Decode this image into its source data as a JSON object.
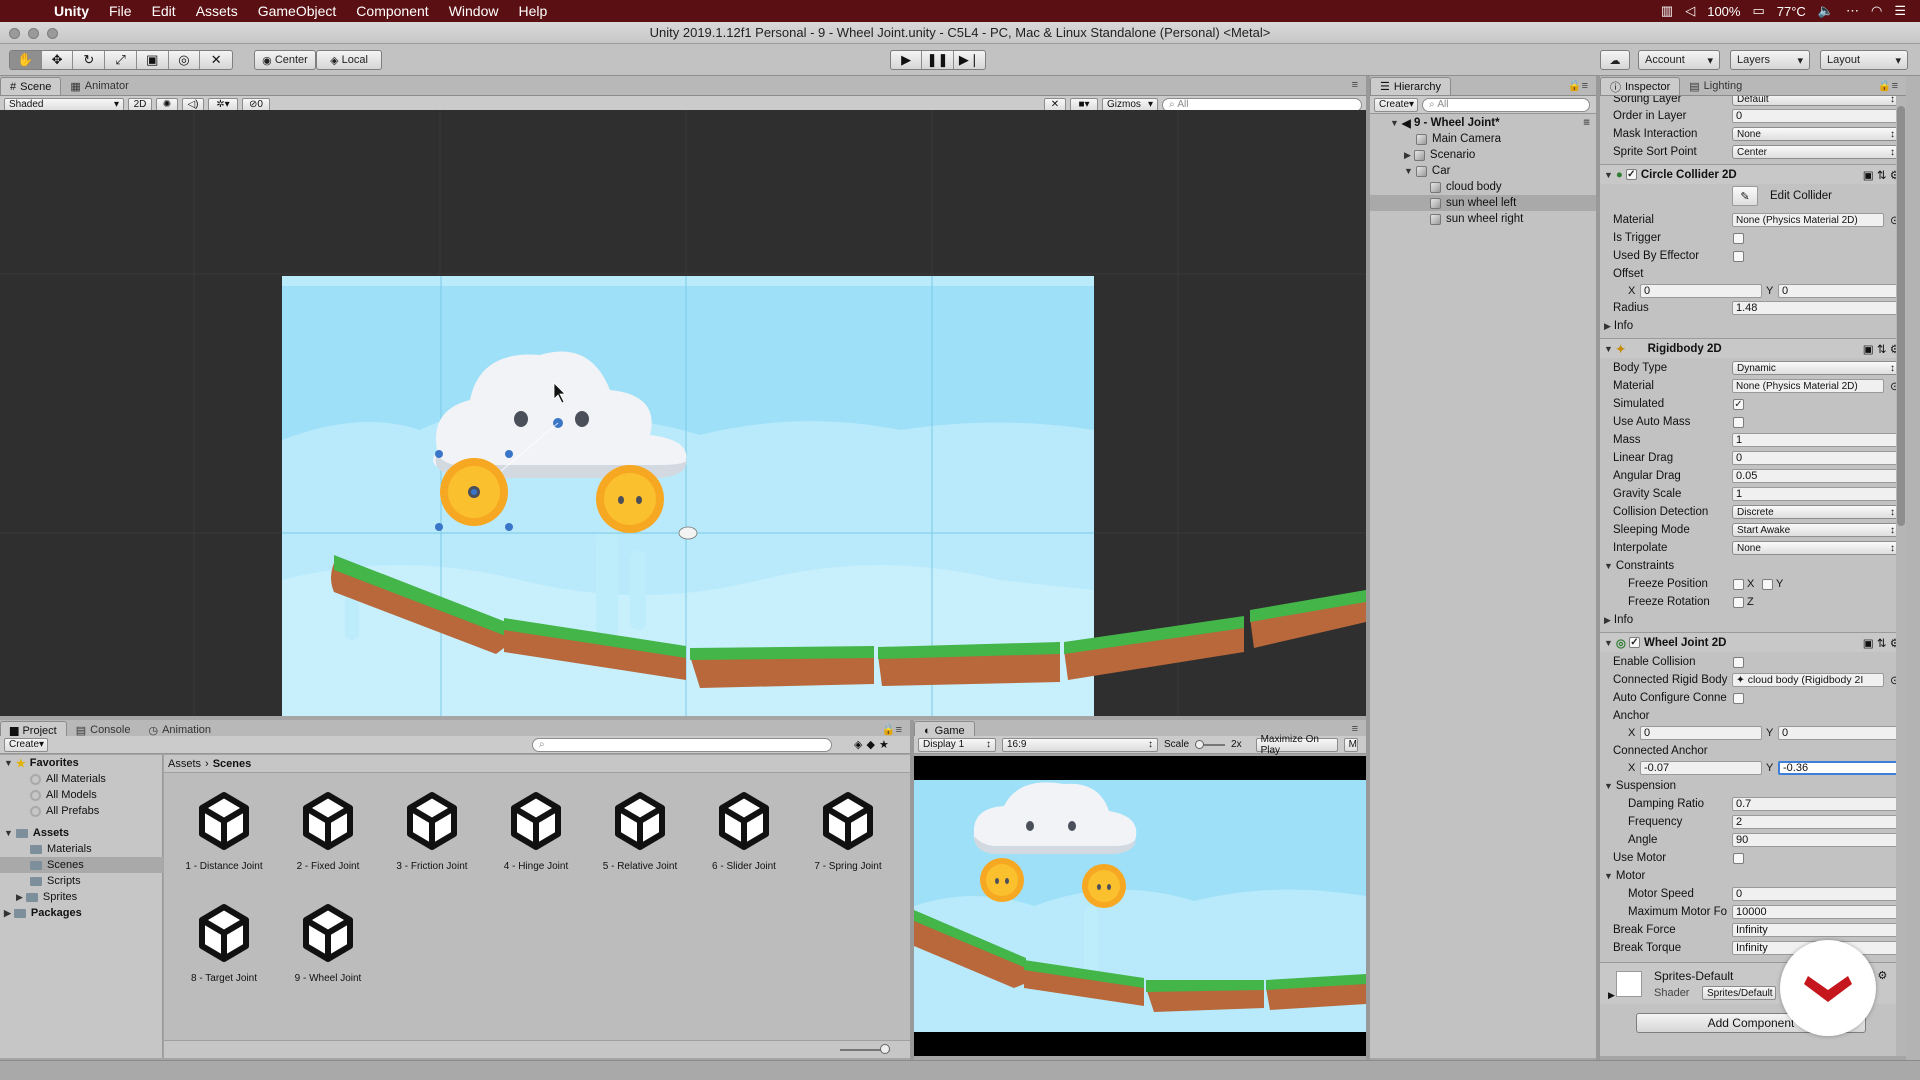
{
  "menubar": {
    "app": "Unity",
    "items": [
      "File",
      "Edit",
      "Assets",
      "GameObject",
      "Component",
      "Window",
      "Help"
    ],
    "status": {
      "battery": "100%",
      "weather": "77°C"
    }
  },
  "titlebar": {
    "title": "Unity 2019.1.12f1 Personal - 9 - Wheel Joint.unity - C5L4 - PC, Mac & Linux Standalone (Personal) <Metal>"
  },
  "toolbar": {
    "pivot": "Center",
    "space": "Local",
    "account": "Account",
    "layers": "Layers",
    "layout": "Layout"
  },
  "scene_panel": {
    "tabs": [
      "Scene",
      "Animator"
    ],
    "shading": "Shaded",
    "mode2d": "2D",
    "fx_count": "0",
    "gizmos": "Gizmos",
    "search_placeholder": "All"
  },
  "hierarchy": {
    "tab": "Hierarchy",
    "create": "Create",
    "search_placeholder": "All",
    "scene": "9 - Wheel Joint*",
    "items": [
      {
        "label": "Main Camera"
      },
      {
        "label": "Scenario"
      },
      {
        "label": "Car"
      },
      {
        "label": "cloud body"
      },
      {
        "label": "sun wheel left"
      },
      {
        "label": "sun wheel right"
      }
    ]
  },
  "inspector": {
    "tabs": [
      "Inspector",
      "Lighting"
    ],
    "sprite_renderer": {
      "sorting_layer_label": "Sorting Layer",
      "sorting_layer": "Default",
      "order_label": "Order in Layer",
      "order": "0",
      "mask_label": "Mask Interaction",
      "mask": "None",
      "sort_point_label": "Sprite Sort Point",
      "sort_point": "Center"
    },
    "circle_collider": {
      "title": "Circle Collider 2D",
      "edit": "Edit Collider",
      "material_label": "Material",
      "material": "None (Physics Material 2D)",
      "trigger_label": "Is Trigger",
      "effector_label": "Used By Effector",
      "offset_label": "Offset",
      "offset_x": "0",
      "offset_y": "0",
      "radius_label": "Radius",
      "radius": "1.48",
      "info": "Info"
    },
    "rigidbody": {
      "title": "Rigidbody 2D",
      "body_type_label": "Body Type",
      "body_type": "Dynamic",
      "material_label": "Material",
      "material": "None (Physics Material 2D)",
      "simulated_label": "Simulated",
      "auto_mass_label": "Use Auto Mass",
      "mass_label": "Mass",
      "mass": "1",
      "linear_drag_label": "Linear Drag",
      "linear_drag": "0",
      "angular_drag_label": "Angular Drag",
      "angular_drag": "0.05",
      "gravity_label": "Gravity Scale",
      "gravity": "1",
      "collision_label": "Collision Detection",
      "collision": "Discrete",
      "sleeping_label": "Sleeping Mode",
      "sleeping": "Start Awake",
      "interpolate_label": "Interpolate",
      "interpolate": "None",
      "constraints": "Constraints",
      "freeze_pos_label": "Freeze Position",
      "freeze_rot_label": "Freeze Rotation",
      "info": "Info"
    },
    "wheel_joint": {
      "title": "Wheel Joint 2D",
      "enable_collision_label": "Enable Collision",
      "connected_label": "Connected Rigid Body",
      "connected": "cloud body (Rigidbody 2I",
      "auto_configure_label": "Auto Configure Conne",
      "anchor_label": "Anchor",
      "anchor_x": "0",
      "anchor_y": "0",
      "connected_anchor_label": "Connected Anchor",
      "connected_anchor_x": "-0.07",
      "connected_anchor_y": "-0.36",
      "suspension": "Suspension",
      "damping_label": "Damping Ratio",
      "damping": "0.7",
      "frequency_label": "Frequency",
      "frequency": "2",
      "angle_label": "Angle",
      "angle": "90",
      "use_motor_label": "Use Motor",
      "motor": "Motor",
      "motor_speed_label": "Motor Speed",
      "motor_speed": "0",
      "max_force_label": "Maximum Motor Fo",
      "max_force": "10000",
      "break_force_label": "Break Force",
      "break_force": "Infinity",
      "break_torque_label": "Break Torque",
      "break_torque": "Infinity"
    },
    "material_block": {
      "name": "Sprites-Default",
      "shader_label": "Shader",
      "shader": "Sprites/Default"
    },
    "add_component": "Add Component"
  },
  "project": {
    "tabs": [
      "Project",
      "Console",
      "Animation"
    ],
    "create": "Create",
    "favorites": "Favorites",
    "fav_items": [
      "All Materials",
      "All Models",
      "All Prefabs"
    ],
    "assets": "Assets",
    "asset_folders": [
      "Materials",
      "Scenes",
      "Scripts",
      "Sprites"
    ],
    "packages": "Packages",
    "breadcrumb": [
      "Assets",
      "Scenes"
    ],
    "scenes": [
      "1 - Distance Joint",
      "2 - Fixed Joint",
      "3 - Friction Joint",
      "4 - Hinge Joint",
      "5 - Relative Joint",
      "6 - Slider Joint",
      "7 - Spring Joint",
      "8 - Target Joint",
      "9 - Wheel Joint"
    ]
  },
  "game": {
    "tab": "Game",
    "display": "Display 1",
    "aspect": "16:9",
    "scale_label": "Scale",
    "scale": "2x",
    "maximize": "Maximize On Play",
    "more": "M"
  },
  "colors": {
    "menubar": "#5a0f12",
    "sky": "#9ee0f8",
    "grass": "#43b549",
    "dirt": "#b8683a",
    "sun": "#f7a823",
    "selection": "#a9a9a9"
  }
}
